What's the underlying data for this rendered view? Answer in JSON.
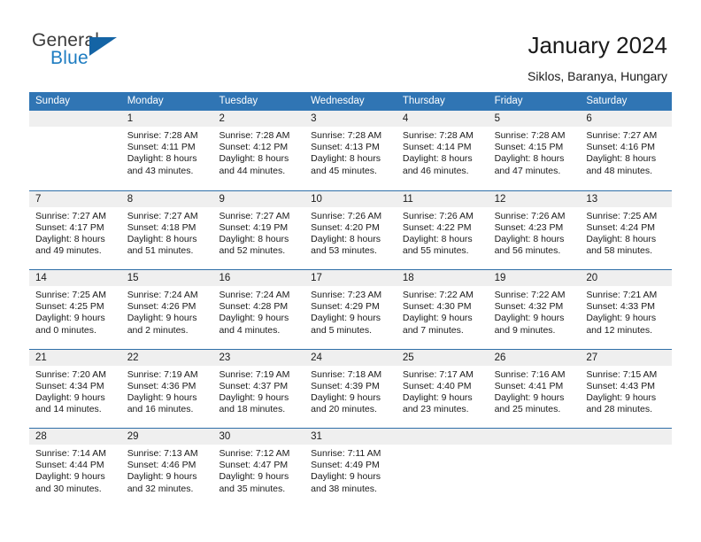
{
  "brand": {
    "name_part1": "General",
    "name_part2": "Blue",
    "triangle_color": "#1464a5",
    "blue_color": "#1d7cc1"
  },
  "header": {
    "title": "January 2024",
    "subtitle": "Siklos, Baranya, Hungary"
  },
  "calendar": {
    "header_bg": "#3075b4",
    "daynum_bg": "#efefef",
    "weekdays": [
      "Sunday",
      "Monday",
      "Tuesday",
      "Wednesday",
      "Thursday",
      "Friday",
      "Saturday"
    ],
    "weeks": [
      [
        {
          "day": "",
          "sunrise": "",
          "sunset": "",
          "daylight_line1": "",
          "daylight_line2": ""
        },
        {
          "day": "1",
          "sunrise": "Sunrise: 7:28 AM",
          "sunset": "Sunset: 4:11 PM",
          "daylight_line1": "Daylight: 8 hours",
          "daylight_line2": "and 43 minutes."
        },
        {
          "day": "2",
          "sunrise": "Sunrise: 7:28 AM",
          "sunset": "Sunset: 4:12 PM",
          "daylight_line1": "Daylight: 8 hours",
          "daylight_line2": "and 44 minutes."
        },
        {
          "day": "3",
          "sunrise": "Sunrise: 7:28 AM",
          "sunset": "Sunset: 4:13 PM",
          "daylight_line1": "Daylight: 8 hours",
          "daylight_line2": "and 45 minutes."
        },
        {
          "day": "4",
          "sunrise": "Sunrise: 7:28 AM",
          "sunset": "Sunset: 4:14 PM",
          "daylight_line1": "Daylight: 8 hours",
          "daylight_line2": "and 46 minutes."
        },
        {
          "day": "5",
          "sunrise": "Sunrise: 7:28 AM",
          "sunset": "Sunset: 4:15 PM",
          "daylight_line1": "Daylight: 8 hours",
          "daylight_line2": "and 47 minutes."
        },
        {
          "day": "6",
          "sunrise": "Sunrise: 7:27 AM",
          "sunset": "Sunset: 4:16 PM",
          "daylight_line1": "Daylight: 8 hours",
          "daylight_line2": "and 48 minutes."
        }
      ],
      [
        {
          "day": "7",
          "sunrise": "Sunrise: 7:27 AM",
          "sunset": "Sunset: 4:17 PM",
          "daylight_line1": "Daylight: 8 hours",
          "daylight_line2": "and 49 minutes."
        },
        {
          "day": "8",
          "sunrise": "Sunrise: 7:27 AM",
          "sunset": "Sunset: 4:18 PM",
          "daylight_line1": "Daylight: 8 hours",
          "daylight_line2": "and 51 minutes."
        },
        {
          "day": "9",
          "sunrise": "Sunrise: 7:27 AM",
          "sunset": "Sunset: 4:19 PM",
          "daylight_line1": "Daylight: 8 hours",
          "daylight_line2": "and 52 minutes."
        },
        {
          "day": "10",
          "sunrise": "Sunrise: 7:26 AM",
          "sunset": "Sunset: 4:20 PM",
          "daylight_line1": "Daylight: 8 hours",
          "daylight_line2": "and 53 minutes."
        },
        {
          "day": "11",
          "sunrise": "Sunrise: 7:26 AM",
          "sunset": "Sunset: 4:22 PM",
          "daylight_line1": "Daylight: 8 hours",
          "daylight_line2": "and 55 minutes."
        },
        {
          "day": "12",
          "sunrise": "Sunrise: 7:26 AM",
          "sunset": "Sunset: 4:23 PM",
          "daylight_line1": "Daylight: 8 hours",
          "daylight_line2": "and 56 minutes."
        },
        {
          "day": "13",
          "sunrise": "Sunrise: 7:25 AM",
          "sunset": "Sunset: 4:24 PM",
          "daylight_line1": "Daylight: 8 hours",
          "daylight_line2": "and 58 minutes."
        }
      ],
      [
        {
          "day": "14",
          "sunrise": "Sunrise: 7:25 AM",
          "sunset": "Sunset: 4:25 PM",
          "daylight_line1": "Daylight: 9 hours",
          "daylight_line2": "and 0 minutes."
        },
        {
          "day": "15",
          "sunrise": "Sunrise: 7:24 AM",
          "sunset": "Sunset: 4:26 PM",
          "daylight_line1": "Daylight: 9 hours",
          "daylight_line2": "and 2 minutes."
        },
        {
          "day": "16",
          "sunrise": "Sunrise: 7:24 AM",
          "sunset": "Sunset: 4:28 PM",
          "daylight_line1": "Daylight: 9 hours",
          "daylight_line2": "and 4 minutes."
        },
        {
          "day": "17",
          "sunrise": "Sunrise: 7:23 AM",
          "sunset": "Sunset: 4:29 PM",
          "daylight_line1": "Daylight: 9 hours",
          "daylight_line2": "and 5 minutes."
        },
        {
          "day": "18",
          "sunrise": "Sunrise: 7:22 AM",
          "sunset": "Sunset: 4:30 PM",
          "daylight_line1": "Daylight: 9 hours",
          "daylight_line2": "and 7 minutes."
        },
        {
          "day": "19",
          "sunrise": "Sunrise: 7:22 AM",
          "sunset": "Sunset: 4:32 PM",
          "daylight_line1": "Daylight: 9 hours",
          "daylight_line2": "and 9 minutes."
        },
        {
          "day": "20",
          "sunrise": "Sunrise: 7:21 AM",
          "sunset": "Sunset: 4:33 PM",
          "daylight_line1": "Daylight: 9 hours",
          "daylight_line2": "and 12 minutes."
        }
      ],
      [
        {
          "day": "21",
          "sunrise": "Sunrise: 7:20 AM",
          "sunset": "Sunset: 4:34 PM",
          "daylight_line1": "Daylight: 9 hours",
          "daylight_line2": "and 14 minutes."
        },
        {
          "day": "22",
          "sunrise": "Sunrise: 7:19 AM",
          "sunset": "Sunset: 4:36 PM",
          "daylight_line1": "Daylight: 9 hours",
          "daylight_line2": "and 16 minutes."
        },
        {
          "day": "23",
          "sunrise": "Sunrise: 7:19 AM",
          "sunset": "Sunset: 4:37 PM",
          "daylight_line1": "Daylight: 9 hours",
          "daylight_line2": "and 18 minutes."
        },
        {
          "day": "24",
          "sunrise": "Sunrise: 7:18 AM",
          "sunset": "Sunset: 4:39 PM",
          "daylight_line1": "Daylight: 9 hours",
          "daylight_line2": "and 20 minutes."
        },
        {
          "day": "25",
          "sunrise": "Sunrise: 7:17 AM",
          "sunset": "Sunset: 4:40 PM",
          "daylight_line1": "Daylight: 9 hours",
          "daylight_line2": "and 23 minutes."
        },
        {
          "day": "26",
          "sunrise": "Sunrise: 7:16 AM",
          "sunset": "Sunset: 4:41 PM",
          "daylight_line1": "Daylight: 9 hours",
          "daylight_line2": "and 25 minutes."
        },
        {
          "day": "27",
          "sunrise": "Sunrise: 7:15 AM",
          "sunset": "Sunset: 4:43 PM",
          "daylight_line1": "Daylight: 9 hours",
          "daylight_line2": "and 28 minutes."
        }
      ],
      [
        {
          "day": "28",
          "sunrise": "Sunrise: 7:14 AM",
          "sunset": "Sunset: 4:44 PM",
          "daylight_line1": "Daylight: 9 hours",
          "daylight_line2": "and 30 minutes."
        },
        {
          "day": "29",
          "sunrise": "Sunrise: 7:13 AM",
          "sunset": "Sunset: 4:46 PM",
          "daylight_line1": "Daylight: 9 hours",
          "daylight_line2": "and 32 minutes."
        },
        {
          "day": "30",
          "sunrise": "Sunrise: 7:12 AM",
          "sunset": "Sunset: 4:47 PM",
          "daylight_line1": "Daylight: 9 hours",
          "daylight_line2": "and 35 minutes."
        },
        {
          "day": "31",
          "sunrise": "Sunrise: 7:11 AM",
          "sunset": "Sunset: 4:49 PM",
          "daylight_line1": "Daylight: 9 hours",
          "daylight_line2": "and 38 minutes."
        },
        {
          "day": "",
          "sunrise": "",
          "sunset": "",
          "daylight_line1": "",
          "daylight_line2": ""
        },
        {
          "day": "",
          "sunrise": "",
          "sunset": "",
          "daylight_line1": "",
          "daylight_line2": ""
        },
        {
          "day": "",
          "sunrise": "",
          "sunset": "",
          "daylight_line1": "",
          "daylight_line2": ""
        }
      ]
    ]
  }
}
